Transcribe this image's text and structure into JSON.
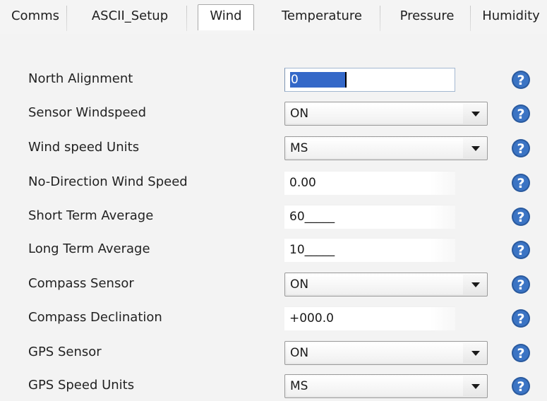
{
  "tabs": [
    {
      "label": "Comms",
      "active": false
    },
    {
      "label": "ASCII_Setup",
      "active": false
    },
    {
      "label": "Wind",
      "active": true
    },
    {
      "label": "Temperature",
      "active": false
    },
    {
      "label": "Pressure",
      "active": false
    },
    {
      "label": "Humidity",
      "active": false
    }
  ],
  "form": {
    "rows": [
      {
        "label": "North Alignment",
        "type": "text",
        "value": "0",
        "selected": true
      },
      {
        "label": "Sensor Windspeed",
        "type": "select",
        "value": "ON"
      },
      {
        "label": "Wind speed Units",
        "type": "select",
        "value": "MS"
      },
      {
        "label": "No-Direction Wind Speed",
        "type": "text",
        "value": "0.00"
      },
      {
        "label": "Short Term Average",
        "type": "text",
        "value": "60_____"
      },
      {
        "label": "Long Term Average",
        "type": "text",
        "value": "10_____"
      },
      {
        "label": "Compass Sensor",
        "type": "select",
        "value": "ON"
      },
      {
        "label": "Compass Declination",
        "type": "text",
        "value": "+000.0"
      },
      {
        "label": "GPS Sensor",
        "type": "select",
        "value": "ON"
      },
      {
        "label": "GPS Speed Units",
        "type": "select",
        "value": "MS"
      }
    ]
  },
  "help_icon": {
    "icon": "help-icon",
    "glyph": "?"
  },
  "colors": {
    "accent_selection": "#3468c8",
    "help_icon_fill": "#2a5a9e"
  }
}
